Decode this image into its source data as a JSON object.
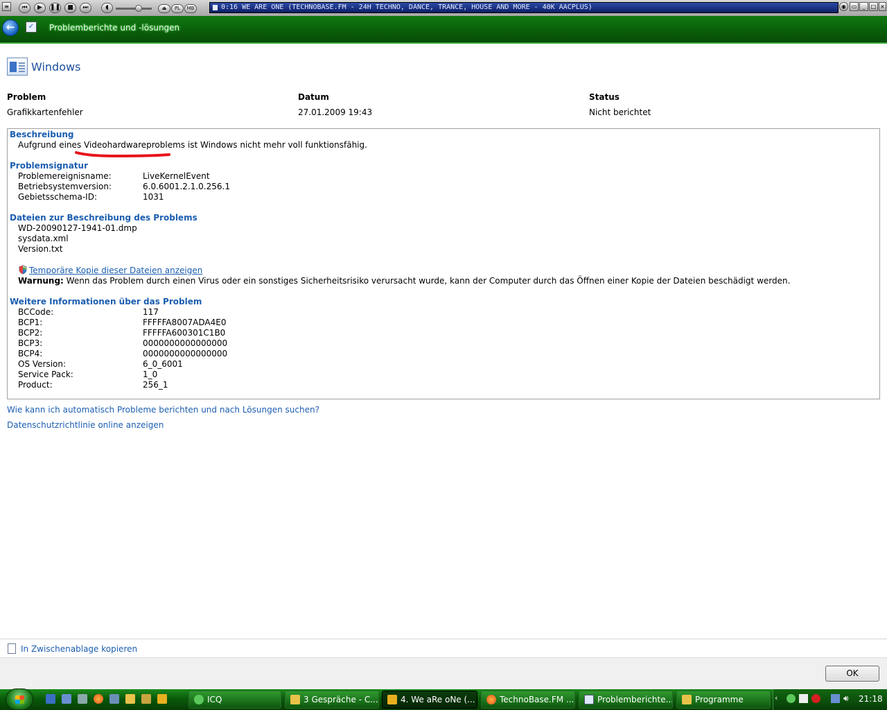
{
  "winamp": {
    "track_text": "0:16   WE ARE ONE (TECHNOBASE.FM - 24H TECHNO, DANCE, TRANCE, HOUSE AND MORE - 40K AACPLUS)",
    "pl_label": "PL",
    "mb_label": "MB"
  },
  "window": {
    "title": "Problemberichte und -lösungen"
  },
  "header": {
    "product": "Windows"
  },
  "columns": {
    "problem_label": "Problem",
    "date_label": "Datum",
    "status_label": "Status",
    "problem_value": "Grafikkartenfehler",
    "date_value": "27.01.2009 19:43",
    "status_value": "Nicht berichtet"
  },
  "description": {
    "heading": "Beschreibung",
    "text": "Aufgrund eines Videohardwareproblems ist Windows nicht mehr voll funktionsfähig."
  },
  "signature": {
    "heading": "Problemsignatur",
    "rows": [
      {
        "label": "Problemereignisname:",
        "value": "LiveKernelEvent"
      },
      {
        "label": "Betriebsystemversion:",
        "value": "6.0.6001.2.1.0.256.1"
      },
      {
        "label": "Gebietsschema-ID:",
        "value": "1031"
      }
    ]
  },
  "files": {
    "heading": "Dateien zur Beschreibung des Problems",
    "items": [
      "WD-20090127-1941-01.dmp",
      "sysdata.xml",
      "Version.txt"
    ],
    "view_copy_link": "Temporäre Kopie dieser Dateien anzeigen",
    "warning_label": "Warnung:",
    "warning_text": "Wenn das Problem durch einen Virus oder ein sonstiges Sicherheitsrisiko verursacht wurde, kann der Computer durch das Öffnen einer Kopie der Dateien beschädigt werden."
  },
  "more_info": {
    "heading": "Weitere Informationen über das Problem",
    "rows": [
      {
        "label": "BCCode:",
        "value": "117"
      },
      {
        "label": "BCP1:",
        "value": "FFFFFA8007ADA4E0"
      },
      {
        "label": "BCP2:",
        "value": "FFFFFA600301C1B0"
      },
      {
        "label": "BCP3:",
        "value": "0000000000000000"
      },
      {
        "label": "BCP4:",
        "value": "0000000000000000"
      },
      {
        "label": "OS Version:",
        "value": "6_0_6001"
      },
      {
        "label": "Service Pack:",
        "value": "1_0"
      },
      {
        "label": "Product:",
        "value": "256_1"
      }
    ]
  },
  "links": {
    "auto_report": "Wie kann ich automatisch Probleme berichten und nach Lösungen suchen?",
    "privacy": "Datenschutzrichtlinie online anzeigen",
    "copy_clipboard": "In Zwischenablage kopieren"
  },
  "buttons": {
    "ok": "OK"
  },
  "taskbar": {
    "tasks": [
      {
        "label": "ICQ"
      },
      {
        "label": "3 Gespräche - C..."
      },
      {
        "label": "4. We aRe oNe (..."
      },
      {
        "label": "TechnoBase.FM ..."
      },
      {
        "label": "Problemberichte..."
      },
      {
        "label": "Programme"
      }
    ],
    "clock": "21:18"
  },
  "colors": {
    "link": "#1c5eb0",
    "titlebar": "#0a5c0a",
    "underline_annotation": "#e8141c"
  }
}
